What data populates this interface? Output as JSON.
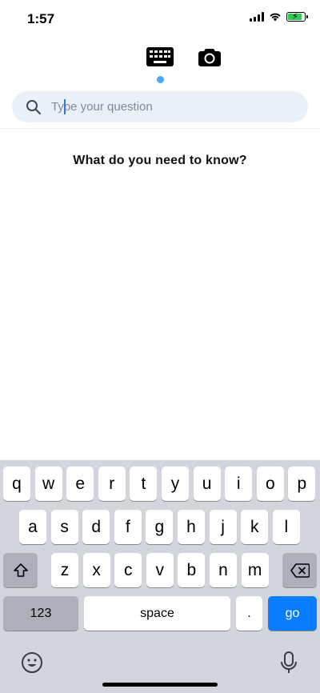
{
  "status_bar": {
    "time": "1:57"
  },
  "modes": {
    "keyboard_icon": "keyboard-icon",
    "camera_icon": "camera-icon"
  },
  "search": {
    "icon": "search-icon",
    "placeholder": "Type your question",
    "value": ""
  },
  "main": {
    "prompt": "What do you need to know?"
  },
  "keyboard": {
    "row1": [
      "q",
      "w",
      "e",
      "r",
      "t",
      "y",
      "u",
      "i",
      "o",
      "p"
    ],
    "row2": [
      "a",
      "s",
      "d",
      "f",
      "g",
      "h",
      "j",
      "k",
      "l"
    ],
    "row3": [
      "z",
      "x",
      "c",
      "v",
      "b",
      "n",
      "m"
    ],
    "numbers_label": "123",
    "space_label": "space",
    "period_label": ".",
    "go_label": "go",
    "shift_icon": "shift-icon",
    "delete_icon": "delete-icon",
    "emoji_icon": "emoji-icon",
    "mic_icon": "microphone-icon"
  },
  "colors": {
    "accent": "#0a7cff",
    "active_dot": "#4aa8f0",
    "search_bg": "#eaf0f7",
    "keyboard_bg": "#d2d5db"
  }
}
